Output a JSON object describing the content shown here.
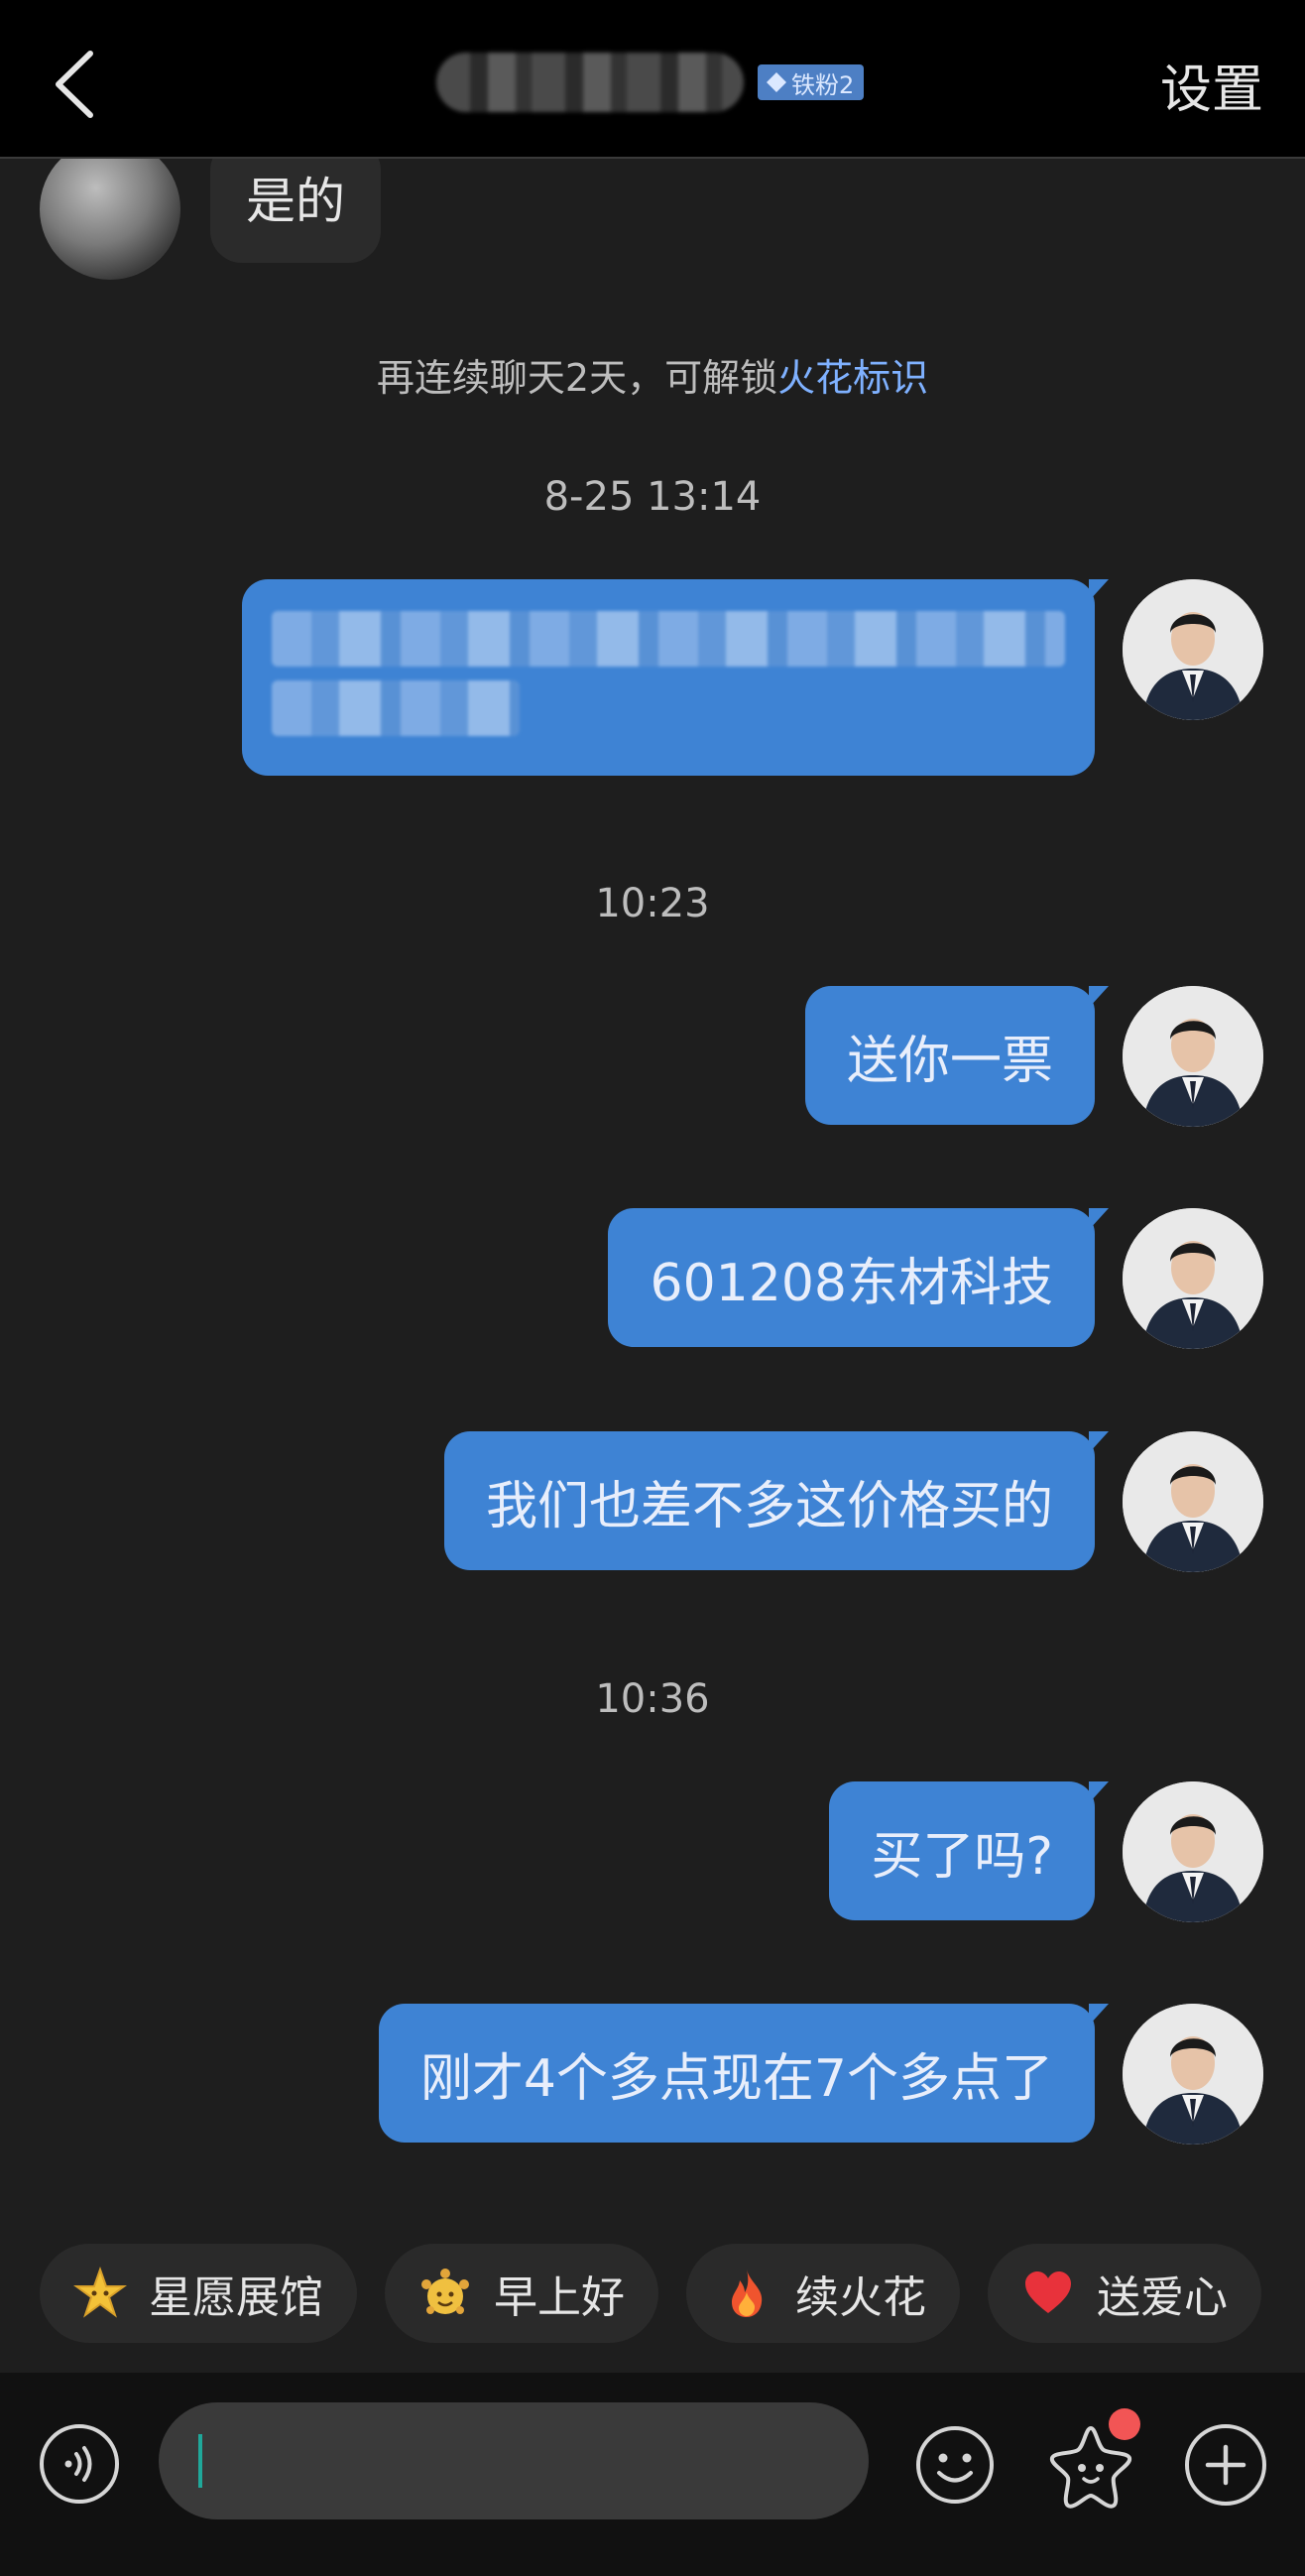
{
  "header": {
    "contact_name": "",
    "badge": "铁粉2",
    "settings_label": "设置"
  },
  "messages": {
    "incoming_text": "是的",
    "system_tip": "再连续聊天2天，可解锁",
    "system_tip_link": "火花标识",
    "ts1": "8-25 13:14",
    "ts2": "10:23",
    "ts3": "10:36",
    "m1": "送你一票",
    "m2": "601208东材科技",
    "m3": "我们也差不多这价格买的",
    "m4": "买了吗?",
    "m5": "刚才4个多点现在7个多点了"
  },
  "quick_replies": [
    {
      "label": "星愿展馆",
      "icon": "star-emoji-icon"
    },
    {
      "label": "早上好",
      "icon": "morning-emoji-icon"
    },
    {
      "label": "续火花",
      "icon": "fire-icon"
    },
    {
      "label": "送爱心",
      "icon": "heart-icon"
    }
  ],
  "colors": {
    "background": "#1e1e1e",
    "bubble_sent": "#3e83d4",
    "bubble_received": "#2b2b2b",
    "link": "#7fb1ff",
    "badge": "#4d7fc4",
    "notification_dot": "#f25555"
  }
}
